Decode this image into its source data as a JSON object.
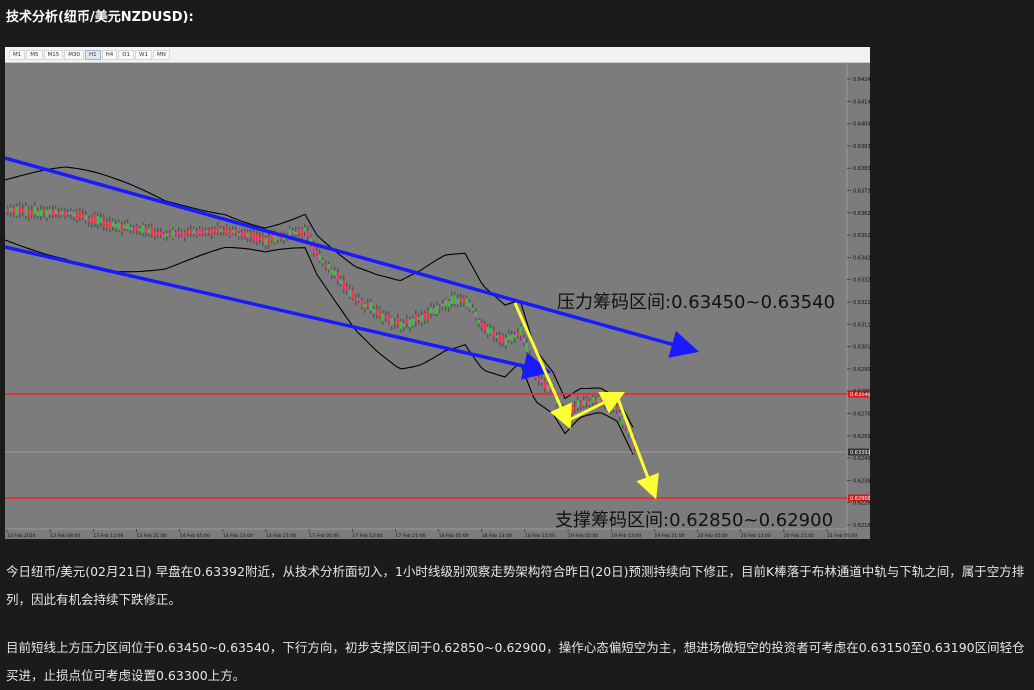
{
  "heading": "技术分析(纽币/美元NZDUSD):",
  "toolbar": {
    "timeframes": [
      "M1",
      "M5",
      "M15",
      "M30",
      "H1",
      "H4",
      "D1",
      "W1",
      "MN"
    ],
    "active": "H1"
  },
  "annotations": {
    "resistance": "压力筹码区间:0.63450~0.63540",
    "support": "支撑筹码区间:0.62850~0.62900"
  },
  "colors": {
    "chart_bg": "#7c7c7c",
    "channel": "#1a1aff",
    "forecast": "#ffff33",
    "level": "#ff2020",
    "bull": "#33cc33",
    "bear": "#ff3333",
    "middle_band": "#ff33ff"
  },
  "chart_data": {
    "type": "candlestick",
    "y_ticks": [
      "0.64245",
      "0.64140",
      "0.64040",
      "0.63935",
      "0.63835",
      "0.63730",
      "0.63625",
      "0.63525",
      "0.63420",
      "0.63320",
      "0.63215",
      "0.63110",
      "0.63010",
      "0.62905",
      "0.62800",
      "0.62700",
      "0.62595",
      "0.62490",
      "0.62385",
      "0.62285",
      "0.62180"
    ],
    "x_ticks": [
      "13 Feb 2020",
      "13 Feb 08:00",
      "13 Feb 13:00",
      "13 Feb 21:00",
      "14 Feb 05:00",
      "14 Feb 13:00",
      "14 Feb 21:00",
      "17 Feb 05:00",
      "17 Feb 13:00",
      "17 Feb 21:00",
      "18 Feb 05:00",
      "18 Feb 13:00",
      "18 Feb 21:00",
      "19 Feb 05:00",
      "19 Feb 13:00",
      "19 Feb 21:00",
      "20 Feb 05:00",
      "20 Feb 13:00",
      "20 Feb 21:00",
      "21 Feb 05:00"
    ],
    "price_markers": [
      "0.63540",
      "0.63392",
      "0.62900"
    ]
  },
  "paragraphs": [
    "今日纽币/美元(02月21日) 早盘在0.63392附近，从技术分析面切入，1小时线级别观察走势架构符合昨日(20日)预测持续向下修正，目前K棒落于布林通道中轨与下轨之间，属于空方排列，因此有机会持续下跌修正。",
    "目前短线上方压力区间位于0.63450~0.63540，下行方向，初步支撑区间于0.62850~0.62900，操作心态偏短空为主，想进场做短空的投资者可考虑在0.63150至0.63190区间轻仓买进，止损点位可考虑设置0.63300上方。"
  ]
}
